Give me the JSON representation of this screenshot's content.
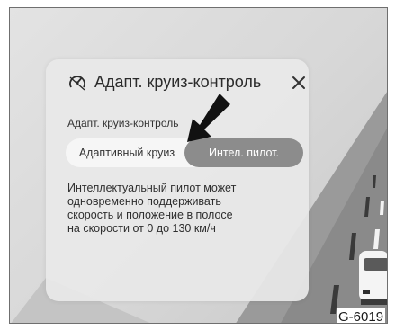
{
  "dialog": {
    "title": "Адапт. круиз-контроль",
    "title_icon": "cruise-control-icon",
    "close_glyph": "✕",
    "section_label": "Адапт. круиз-контроль",
    "options": [
      {
        "label": "Адаптивный круиз",
        "selected": false
      },
      {
        "label": "Интел. пилот.",
        "selected": true
      }
    ],
    "description_lines": [
      "Интеллектуальный пилот может",
      "одновременно поддерживать",
      "скорость и положение в полосе",
      "на скорости от 0 до 130 км/ч"
    ]
  },
  "figure_code": "G-6019",
  "colors": {
    "selected_option_bg": "#8c8c8c",
    "panel_bg": "#e8e8e8",
    "background": "#d7d7d7"
  }
}
